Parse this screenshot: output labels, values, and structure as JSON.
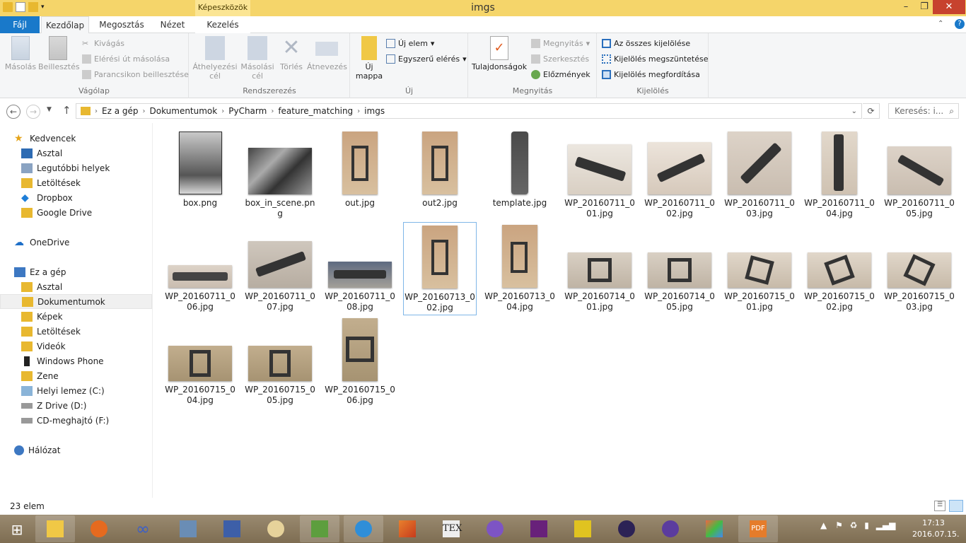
{
  "window": {
    "title": "imgs",
    "context_tab_header": "Képeszközök"
  },
  "tabs": [
    "Fájl",
    "Kezdőlap",
    "Megosztás",
    "Nézet",
    "Kezelés"
  ],
  "ribbon": {
    "clipboard": {
      "label": "Vágólap",
      "copy": "Másolás",
      "paste": "Beillesztés",
      "cut": "Kivágás",
      "copy_path": "Elérési út másolása",
      "paste_shortcut": "Parancsikon beillesztése"
    },
    "organize": {
      "label": "Rendszerezés",
      "move_to": "Áthelyezési",
      "move_to_2": "cél",
      "copy_to": "Másolási",
      "copy_to_2": "cél",
      "delete": "Törlés",
      "rename": "Átnevezés"
    },
    "new": {
      "label": "Új",
      "new_folder": "Új",
      "new_folder_2": "mappa",
      "new_item": "Új elem",
      "easy_access": "Egyszerű elérés"
    },
    "open": {
      "label": "Megnyitás",
      "properties": "Tulajdonságok",
      "open": "Megnyitás",
      "edit": "Szerkesztés",
      "history": "Előzmények"
    },
    "select": {
      "label": "Kijelölés",
      "select_all": "Az összes kijelölése",
      "select_none": "Kijelölés megszüntetése",
      "invert": "Kijelölés megfordítása"
    }
  },
  "address": {
    "crumbs": [
      "Ez a gép",
      "Dokumentumok",
      "PyCharm",
      "feature_matching",
      "imgs"
    ],
    "search_placeholder": "Keresés: i..."
  },
  "nav": {
    "favorites": "Kedvencek",
    "fav_items": [
      "Asztal",
      "Legutóbbi helyek",
      "Letöltések",
      "Dropbox",
      "Google Drive"
    ],
    "onedrive": "OneDrive",
    "thispc": "Ez a gép",
    "pc_items": [
      "Asztal",
      "Dokumentumok",
      "Képek",
      "Letöltések",
      "Videók",
      "Windows Phone",
      "Zene",
      "Helyi lemez (C:)",
      "Z Drive (D:)",
      "CD-meghajtó (F:)"
    ],
    "network": "Hálózat"
  },
  "files": [
    {
      "name": "box.png"
    },
    {
      "name": "box_in_scene.png"
    },
    {
      "name": "out.jpg"
    },
    {
      "name": "out2.jpg"
    },
    {
      "name": "template.jpg"
    },
    {
      "name": "WP_20160711_001.jpg"
    },
    {
      "name": "WP_20160711_002.jpg"
    },
    {
      "name": "WP_20160711_003.jpg"
    },
    {
      "name": "WP_20160711_004.jpg"
    },
    {
      "name": "WP_20160711_005.jpg"
    },
    {
      "name": "WP_20160711_006.jpg"
    },
    {
      "name": "WP_20160711_007.jpg"
    },
    {
      "name": "WP_20160711_008.jpg"
    },
    {
      "name": "WP_20160713_002.jpg"
    },
    {
      "name": "WP_20160713_004.jpg"
    },
    {
      "name": "WP_20160714_001.jpg"
    },
    {
      "name": "WP_20160714_005.jpg"
    },
    {
      "name": "WP_20160715_001.jpg"
    },
    {
      "name": "WP_20160715_002.jpg"
    },
    {
      "name": "WP_20160715_003.jpg"
    },
    {
      "name": "WP_20160715_004.jpg"
    },
    {
      "name": "WP_20160715_005.jpg"
    },
    {
      "name": "WP_20160715_006.jpg"
    }
  ],
  "status": {
    "count": "23 elem"
  },
  "clock": {
    "time": "17:13",
    "date": "2016.07.15."
  }
}
